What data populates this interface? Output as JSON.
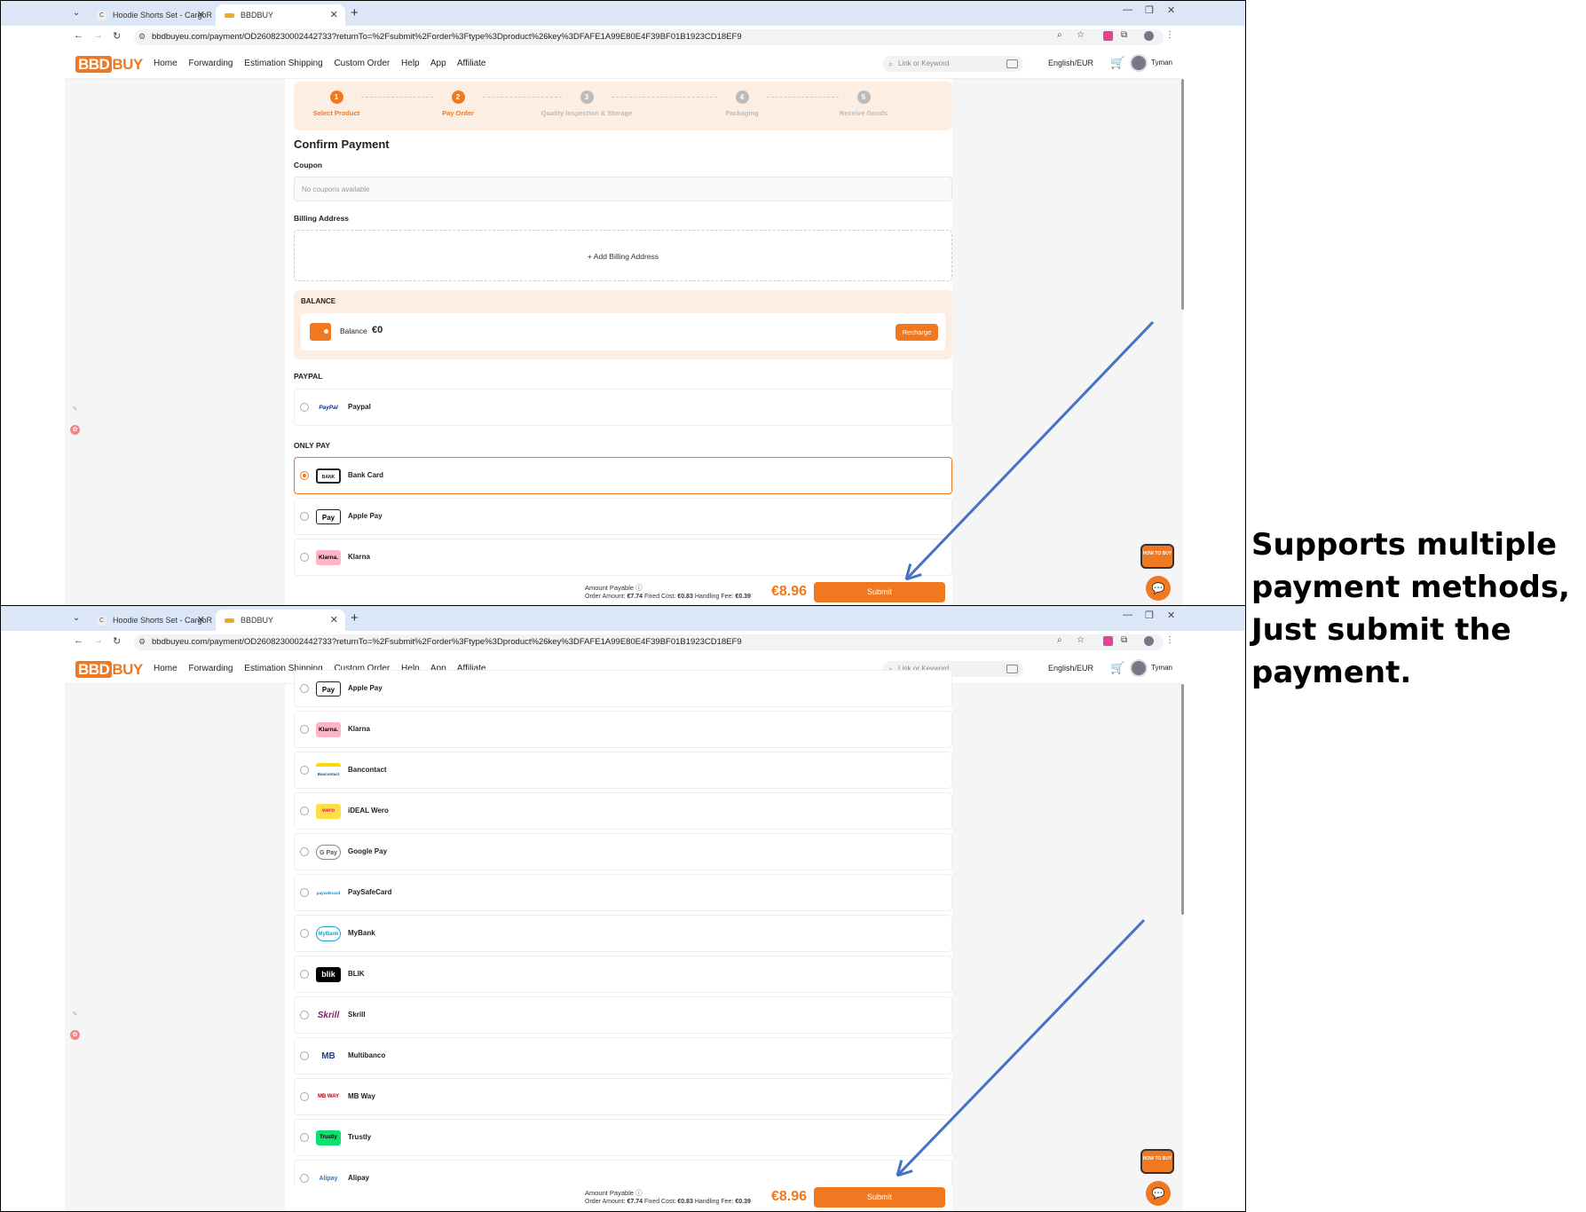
{
  "caption": "Supports multiple payment methods, Just submit the payment.",
  "browser": {
    "tab1_title": "Hoodie Shorts Set - CargoRe",
    "tab1_favicon": "C",
    "tab2_title": "BBDBUY",
    "url": "bbdbuyeu.com/payment/OD2608230002442733?returnTo=%2Fsubmit%2Forder%3Ftype%3Dproduct%26key%3DFAFE1A99E80E4F39BF01B1923CD18EF9"
  },
  "site": {
    "logo_a": "BBD",
    "logo_b": "BUY",
    "menu": [
      "Home",
      "Forwarding",
      "Estimation Shipping",
      "Custom Order",
      "Help",
      "App",
      "Affiliate"
    ],
    "search_placeholder": "Link or Keyword",
    "language": "English/EUR",
    "username": "Tyman"
  },
  "steps": [
    {
      "num": "1",
      "label": "Select Product",
      "active": true
    },
    {
      "num": "2",
      "label": "Pay Order",
      "active": true
    },
    {
      "num": "3",
      "label": "Quality Inspection & Storage",
      "active": false
    },
    {
      "num": "4",
      "label": "Packaging",
      "active": false
    },
    {
      "num": "5",
      "label": "Receive Goods",
      "active": false
    }
  ],
  "payment": {
    "title": "Confirm Payment",
    "coupon_label": "Coupon",
    "coupon_placeholder": "No coupons available",
    "billing_label": "Billing Address",
    "add_billing": "+ Add Billing Address",
    "balance_section": "BALANCE",
    "balance_label": "Balance",
    "balance_value": "€0",
    "recharge": "Recharge",
    "paypal_section": "PAYPAL",
    "onlypay_section": "ONLY PAY"
  },
  "methods_top": [
    {
      "name": "Paypal",
      "logo": "PayPal",
      "selected": false
    },
    {
      "name": "Bank Card",
      "logo": "BANK",
      "selected": true
    },
    {
      "name": "Apple Pay",
      "logo": "Pay",
      "selected": false
    },
    {
      "name": "Klarna",
      "logo": "Klarna.",
      "selected": false
    }
  ],
  "methods_bottom": [
    {
      "name": "Apple Pay",
      "logo": "Pay"
    },
    {
      "name": "Klarna",
      "logo": "Klarna."
    },
    {
      "name": "Bancontact",
      "logo": "Bancontact"
    },
    {
      "name": "iDEAL Wero",
      "logo": "wero"
    },
    {
      "name": "Google Pay",
      "logo": "G Pay"
    },
    {
      "name": "PaySafeCard",
      "logo": "paysafecard"
    },
    {
      "name": "MyBank",
      "logo": "MyBank"
    },
    {
      "name": "BLIK",
      "logo": "blik"
    },
    {
      "name": "Skrill",
      "logo": "Skrill"
    },
    {
      "name": "Multibanco",
      "logo": "MB"
    },
    {
      "name": "MB Way",
      "logo": "MB WAY"
    },
    {
      "name": "Trustly",
      "logo": "Trustly"
    },
    {
      "name": "Alipay",
      "logo": "Alipay"
    }
  ],
  "footer": {
    "amount_label": "Amount Payable",
    "order_amount_label": "Order Amount:",
    "order_amount": "€7.74",
    "fixed_cost_label": "Fixed Cost:",
    "fixed_cost": "€0.83",
    "handling_label": "Handling Fee:",
    "handling": "€0.39",
    "total": "€8.96",
    "submit": "Submit"
  },
  "float_help": "HOW TO BUY",
  "colors": {
    "accent": "#f07820",
    "arrow": "#4472c4"
  }
}
